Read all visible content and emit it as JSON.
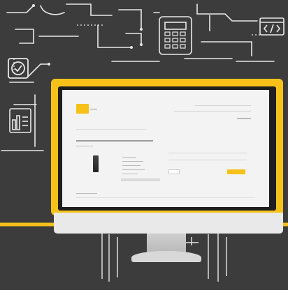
{
  "scene": {
    "accent_color": "#f6c21a",
    "chalkboard_color": "#3c3c3d",
    "icons": [
      "calculator-icon",
      "code-brackets-icon",
      "checkmark-icon",
      "document-chart-icon"
    ],
    "code_icon_text": "</>"
  },
  "webpage": {
    "logo": "",
    "title": "",
    "nav_links": [],
    "buttons": []
  }
}
